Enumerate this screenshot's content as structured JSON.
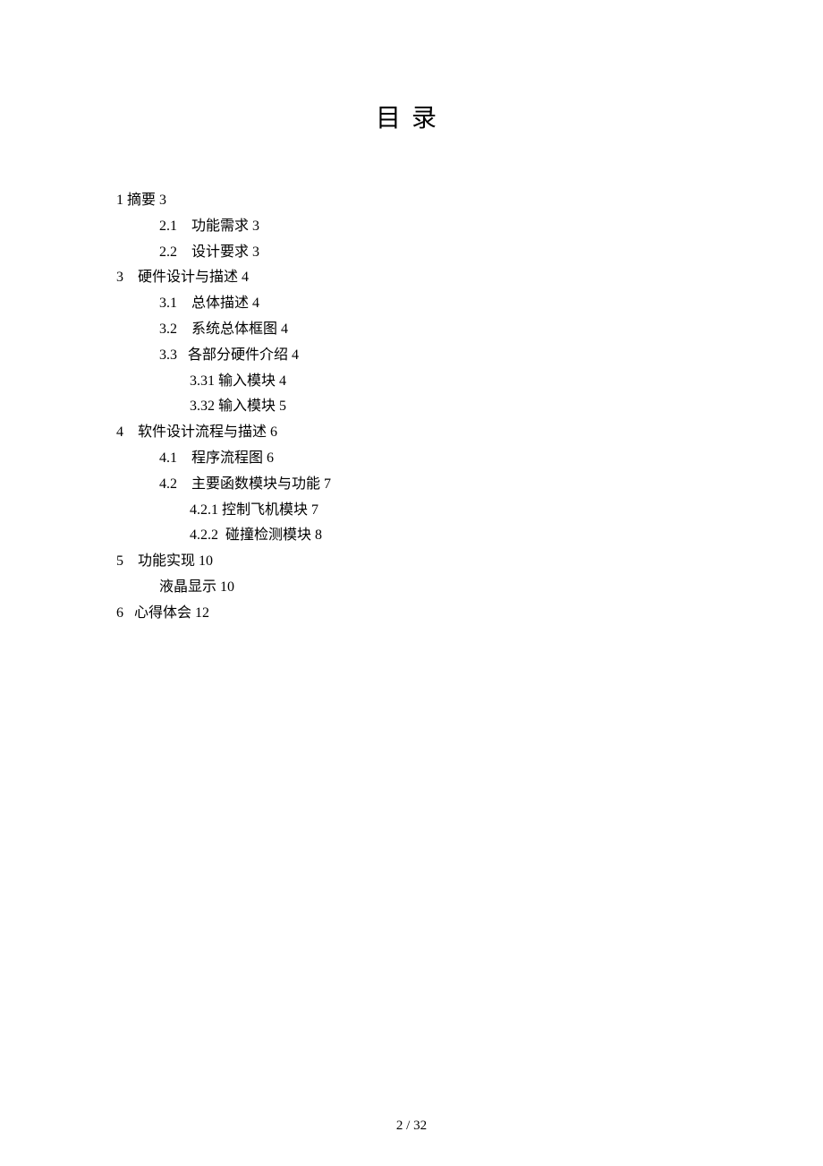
{
  "title": "目录",
  "toc": [
    {
      "level": 0,
      "text": "1 摘要 3"
    },
    {
      "level": 1,
      "text": "2.1    功能需求 3"
    },
    {
      "level": 1,
      "text": "2.2    设计要求 3"
    },
    {
      "level": 0,
      "text": "3    硬件设计与描述 4"
    },
    {
      "level": 1,
      "text": "3.1    总体描述 4"
    },
    {
      "level": 1,
      "text": "3.2    系统总体框图 4"
    },
    {
      "level": 1,
      "text": "3.3   各部分硬件介绍 4"
    },
    {
      "level": 2,
      "text": "3.31 输入模块 4"
    },
    {
      "level": 2,
      "text": "3.32 输入模块 5"
    },
    {
      "level": 0,
      "text": "4    软件设计流程与描述 6"
    },
    {
      "level": 1,
      "text": "4.1    程序流程图 6"
    },
    {
      "level": 1,
      "text": "4.2    主要函数模块与功能 7"
    },
    {
      "level": 2,
      "text": "4.2.1 控制飞机模块 7"
    },
    {
      "level": 2,
      "text": "4.2.2  碰撞检测模块 8"
    },
    {
      "level": 0,
      "text": "5    功能实现 10"
    },
    {
      "level": 1,
      "text": "液晶显示 10"
    },
    {
      "level": 0,
      "text": "6   心得体会 12"
    }
  ],
  "footer": "2  / 32"
}
